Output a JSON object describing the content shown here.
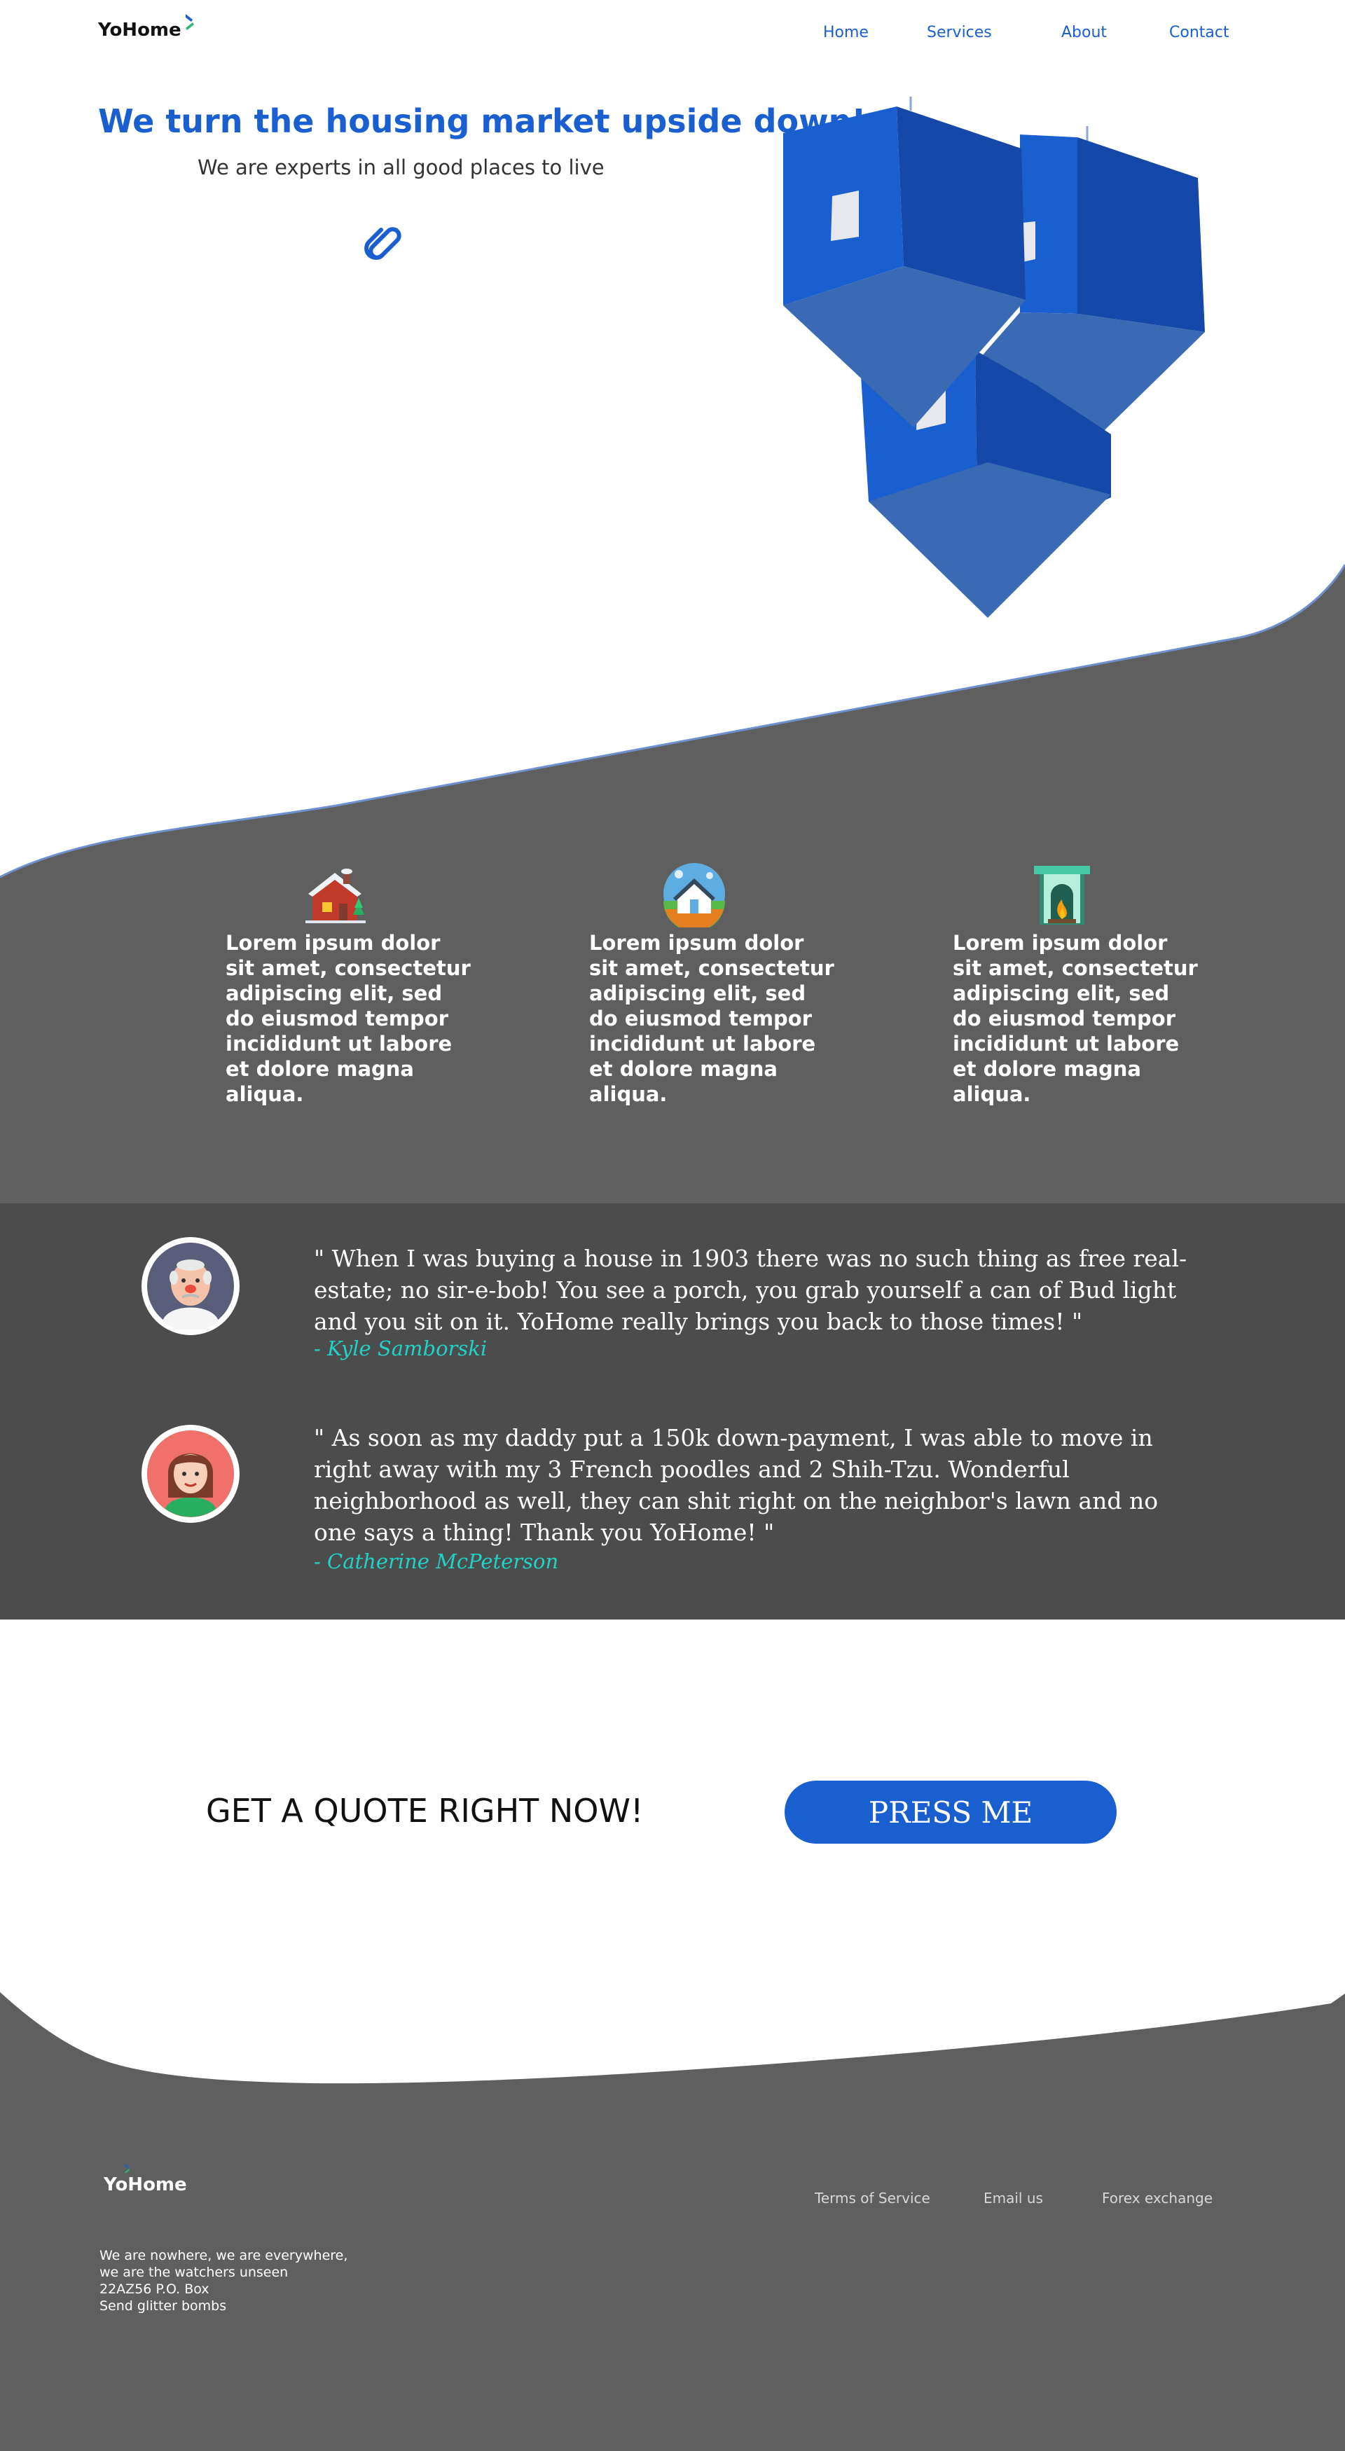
{
  "header": {
    "logo_text": "YoHome",
    "nav": [
      {
        "label": "Home"
      },
      {
        "label": "Services"
      },
      {
        "label": "About"
      },
      {
        "label": "Contact"
      }
    ]
  },
  "hero": {
    "title": "We turn the housing market upside down!",
    "subtitle": "We are experts in all good places to live",
    "link_icon": "paperclip-icon",
    "illustration": "upside-down-houses"
  },
  "features": [
    {
      "icon": "snowy-house-icon",
      "text": "Lorem ipsum dolor sit amet, consectetur adipiscing elit, sed do eiusmod tempor incididunt ut labore et dolore magna aliqua."
    },
    {
      "icon": "house-circle-icon",
      "text": "Lorem ipsum dolor sit amet, consectetur adipiscing elit, sed do eiusmod tempor incididunt ut labore et dolore magna aliqua."
    },
    {
      "icon": "fireplace-icon",
      "text": "Lorem ipsum dolor sit amet, consectetur adipiscing elit, sed do eiusmod tempor incididunt ut labore et dolore magna aliqua."
    }
  ],
  "testimonials": [
    {
      "avatar": "old-man-avatar",
      "quote": "\" When I was buying a house in 1903 there was no such thing as free real-estate; no sir-e-bob! You see a porch, you grab yourself a can of Bud light and you sit on it. YoHome really brings you back to those times! \"",
      "author": "- Kyle Samborski"
    },
    {
      "avatar": "woman-avatar",
      "quote": "\" As soon as my daddy put a 150k down-payment, I was able to move in right away with my 3 French poodles and 2 Shih-Tzu. Wonderful neighborhood as well, they can shit right on the neighbor's lawn and no one says a thing! Thank you YoHome! \"",
      "author": "- Catherine McPeterson"
    }
  ],
  "cta": {
    "text": "GET A QUOTE RIGHT NOW!",
    "button_label": "PRESS ME"
  },
  "footer": {
    "logo_text": "YoHome",
    "links": [
      {
        "label": "Terms of Service"
      },
      {
        "label": "Email us"
      },
      {
        "label": "Forex exchange"
      }
    ],
    "address_lines": [
      "We are nowhere, we are everywhere,",
      "we are the watchers unseen",
      "22AZ56 P.O. Box",
      "Send glitter bombs"
    ]
  },
  "colors": {
    "brand_blue": "#1a5fd0",
    "section_grey": "#5f5f5f",
    "testimonial_grey": "#4c4c4c",
    "author_teal": "#1fd3c6",
    "logo_green": "#2bb673"
  }
}
